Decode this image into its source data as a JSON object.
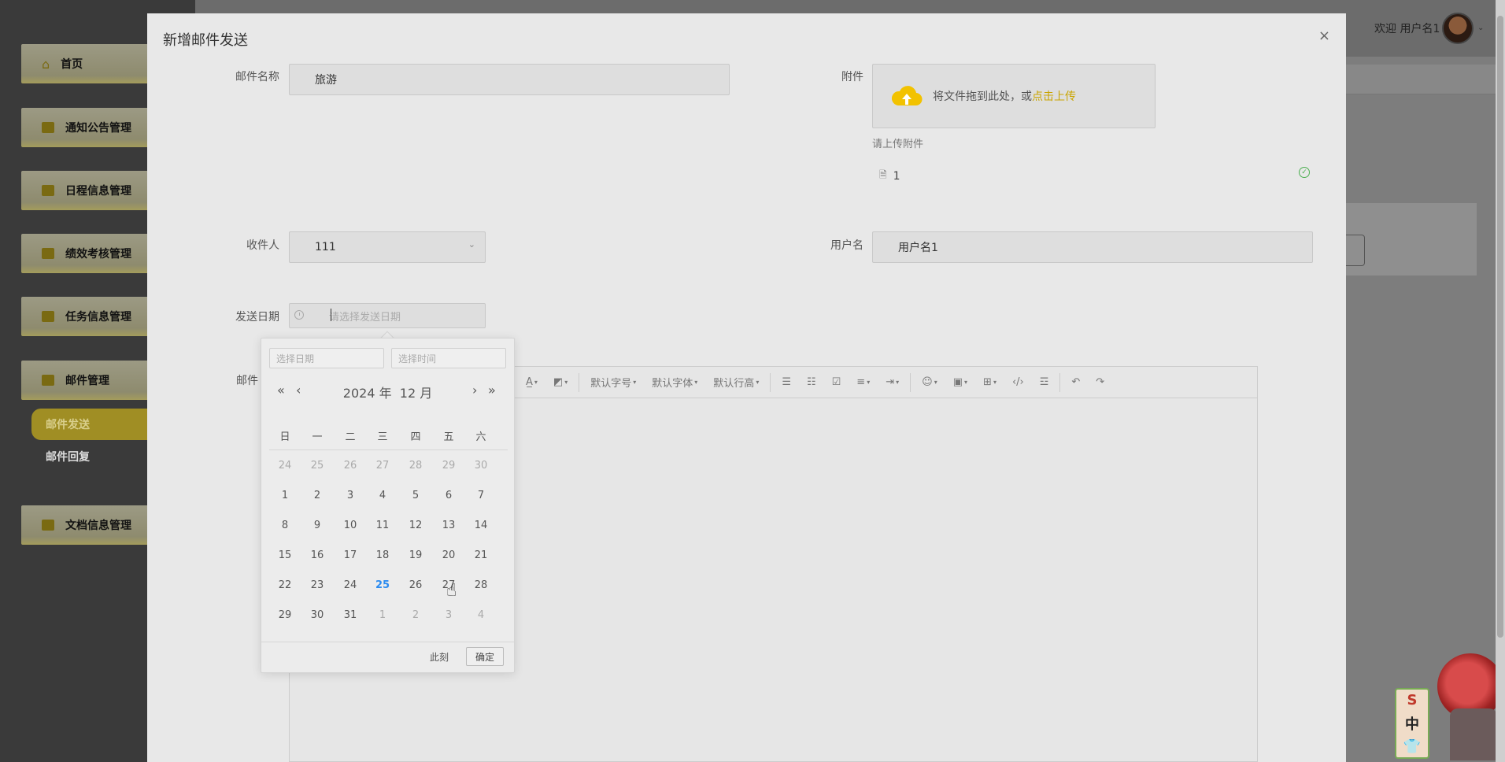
{
  "sidebar": {
    "items": [
      {
        "label": "首页"
      },
      {
        "label": "通知公告管理"
      },
      {
        "label": "日程信息管理"
      },
      {
        "label": "绩效考核管理"
      },
      {
        "label": "任务信息管理"
      },
      {
        "label": "邮件管理"
      },
      {
        "label": "文档信息管理"
      }
    ],
    "sub_items": [
      {
        "label": "邮件发送"
      },
      {
        "label": "邮件回复"
      }
    ]
  },
  "header": {
    "welcome": "欢迎 用户名1"
  },
  "dialog": {
    "title": "新增邮件发送",
    "close": "×",
    "fields": {
      "mail_name_label": "邮件名称",
      "mail_name_value": "旅游",
      "attachment_label": "附件",
      "upload_text": "将文件拖到此处，或",
      "upload_link": "点击上传",
      "upload_tip": "请上传附件",
      "file_name": "1",
      "recipient_label": "收件人",
      "recipient_value": "111",
      "username_label": "用户名",
      "username_value": "用户名1",
      "send_date_label": "发送日期",
      "send_date_placeholder": "请选择发送日期",
      "content_label": "邮件"
    },
    "toolbar": {
      "font_size": "默认字号",
      "font_family": "默认字体",
      "line_height": "默认行高"
    }
  },
  "datepicker": {
    "date_placeholder": "选择日期",
    "time_placeholder": "选择时间",
    "year_label": "2024 年",
    "month_label": "12 月",
    "weekdays": [
      "日",
      "一",
      "二",
      "三",
      "四",
      "五",
      "六"
    ],
    "weeks": [
      [
        {
          "d": "24",
          "o": true
        },
        {
          "d": "25",
          "o": true
        },
        {
          "d": "26",
          "o": true
        },
        {
          "d": "27",
          "o": true
        },
        {
          "d": "28",
          "o": true
        },
        {
          "d": "29",
          "o": true
        },
        {
          "d": "30",
          "o": true
        }
      ],
      [
        {
          "d": "1"
        },
        {
          "d": "2"
        },
        {
          "d": "3"
        },
        {
          "d": "4"
        },
        {
          "d": "5"
        },
        {
          "d": "6"
        },
        {
          "d": "7"
        }
      ],
      [
        {
          "d": "8"
        },
        {
          "d": "9"
        },
        {
          "d": "10"
        },
        {
          "d": "11"
        },
        {
          "d": "12"
        },
        {
          "d": "13"
        },
        {
          "d": "14"
        }
      ],
      [
        {
          "d": "15"
        },
        {
          "d": "16"
        },
        {
          "d": "17"
        },
        {
          "d": "18"
        },
        {
          "d": "19"
        },
        {
          "d": "20"
        },
        {
          "d": "21"
        }
      ],
      [
        {
          "d": "22"
        },
        {
          "d": "23"
        },
        {
          "d": "24"
        },
        {
          "d": "25",
          "today": true
        },
        {
          "d": "26"
        },
        {
          "d": "27"
        },
        {
          "d": "28"
        }
      ],
      [
        {
          "d": "29"
        },
        {
          "d": "30"
        },
        {
          "d": "31"
        },
        {
          "d": "1",
          "o": true
        },
        {
          "d": "2",
          "o": true
        },
        {
          "d": "3",
          "o": true
        },
        {
          "d": "4",
          "o": true
        }
      ]
    ],
    "now_label": "此刻",
    "ok_label": "确定"
  },
  "mascot": {
    "s": "S",
    "zh": "中"
  },
  "colors": {
    "accent": "#c9a400",
    "today": "#2d8cf0",
    "success": "#4caf50"
  }
}
